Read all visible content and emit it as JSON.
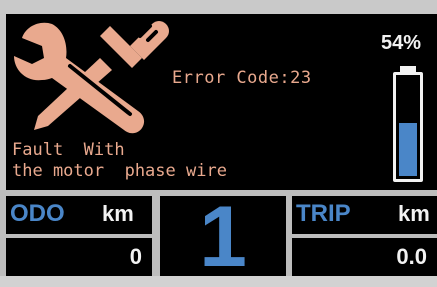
{
  "fault": {
    "error_label": "Error Code:",
    "error_code": "23",
    "message_line1": "Fault  With",
    "message_line2": "the motor  phase wire",
    "icon": "wrench-screwdriver-crossed-icon"
  },
  "battery": {
    "percent_text": "54%",
    "level": 0.54,
    "icon": "battery-icon"
  },
  "odo": {
    "label": "ODO",
    "unit": "km",
    "value": "0"
  },
  "gear": {
    "value": "1"
  },
  "trip": {
    "label": "TRIP",
    "unit": "km",
    "value": "0.0"
  },
  "colors": {
    "fault_text": "#e9a98e",
    "accent_blue": "#4a86c8",
    "background": "#000000",
    "text": "#f2f2f2"
  }
}
